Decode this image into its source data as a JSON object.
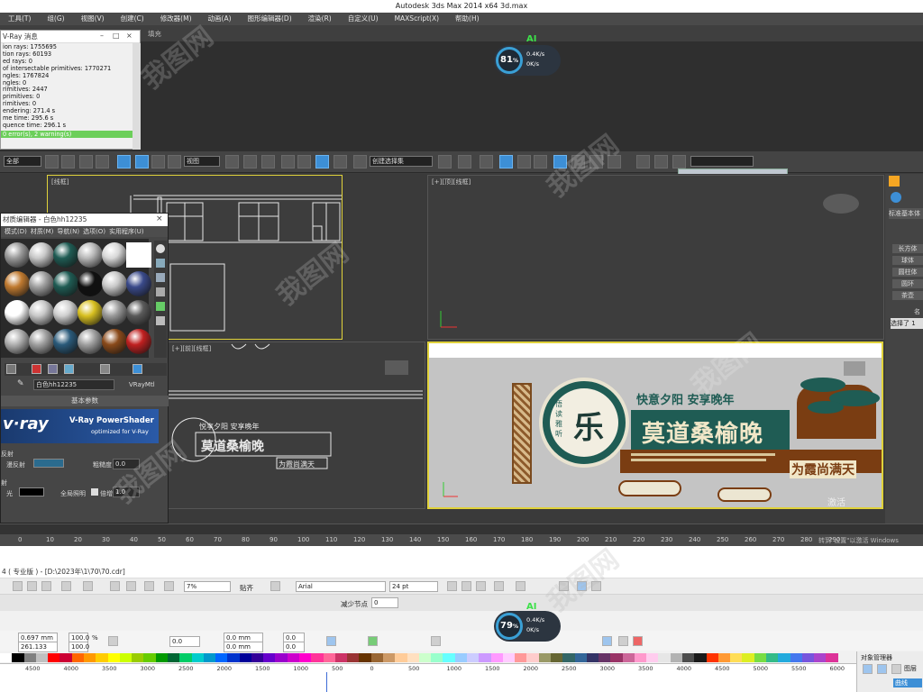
{
  "max": {
    "title": "Autodesk 3ds Max  2014 x64      3d.max",
    "menu": [
      "工具(T)",
      "组(G)",
      "视图(V)",
      "创建(C)",
      "修改器(M)",
      "动画(A)",
      "图形编辑器(D)",
      "渲染(R)",
      "自定义(U)",
      "MAXScript(X)",
      "帮助(H)"
    ],
    "fill_label": "填充",
    "select_filter": "全部",
    "view_dropdown": "视图",
    "selection_set": "创建选择集",
    "viewport_labels": {
      "tl": "[线框]",
      "tr": "[+][顶][线框]",
      "bl": "[+][前][线框]"
    },
    "right_panel": {
      "std": "标准基本体",
      "items": [
        "长方体",
        "球体",
        "圆柱体",
        "圆环",
        "茶壶"
      ],
      "sel": "选择了 1",
      "name": "名"
    },
    "timeline_ticks": [
      "0",
      "10",
      "20",
      "30",
      "40",
      "50",
      "60",
      "70",
      "80",
      "90",
      "100",
      "110",
      "120",
      "130",
      "140",
      "150",
      "160",
      "170",
      "180",
      "190",
      "200",
      "210",
      "220",
      "230",
      "240",
      "250",
      "260",
      "270",
      "280",
      "290"
    ],
    "windows_activate": "激活 Windows",
    "windows_activate_sub": "转到\"设置\"以激活 Windows"
  },
  "vray": {
    "title": "V-Ray 消息",
    "log": [
      "ion rays: 1755695",
      "tion rays: 60193",
      "ed rays: 0",
      "of intersectable primitives: 1770271",
      "ngles: 1767824",
      "ngles: 0",
      "rimitives: 2447",
      " primitives: 0",
      "rimitives: 0",
      "endering: 271.4 s",
      "me time: 295.6 s",
      "quence time: 296.1 s"
    ],
    "status": "0 error(s), 2 warning(s)"
  },
  "mated": {
    "title": "材质编辑器 - 白色hh12235",
    "menu": [
      "模式(D)",
      "材质(M)",
      "导航(N)",
      "选项(O)",
      "实用程序(U)"
    ],
    "material_name": "白色hh12235",
    "material_type": "VRayMtl",
    "section": "基本参数",
    "vray_logo": "v·ray",
    "vray_product": "V-Ray PowerShader",
    "vray_sub": "optimized for V-Ray",
    "diffuse": "漫反射",
    "roughness_label": "粗糙度",
    "roughness_value": "0.0",
    "reflect": "反射",
    "reflect_short": "光",
    "gloss": "全局照明",
    "multiplier": "倍增",
    "multiplier_value": "1.0",
    "refract": "射"
  },
  "sign": {
    "line1": "快意夕阳  安享晚年",
    "main": "莫道桑榆晚",
    "tail": "为霞尚满天",
    "circle": "乐",
    "side": "悟读雅听"
  },
  "speed_top": {
    "ai": "AI",
    "pct": "81",
    "unit": "%",
    "up": "0.4K/s",
    "down": "0K/s"
  },
  "speed_bottom": {
    "ai": "AI",
    "pct": "79",
    "unit": "%",
    "up": "0.4K/s",
    "down": "0K/s"
  },
  "corel": {
    "title": "4 ( 专业版 ) - [D:\\2023年\\1\\70\\70.cdr]",
    "zoom": "7%",
    "snap": "贴齐",
    "font": "Arial",
    "size": "24 pt",
    "width": "0.697 mm",
    "height": "261.133 mm",
    "scale_x": "100.0",
    "scale_y": "100.0",
    "pct": "%",
    "angle": "0.0",
    "x_off": "0.0 mm",
    "y_off": "0.0 mm",
    "reduce_nodes": "减少节点",
    "reduce_value": "0",
    "obj_manager": "对象管理器",
    "layer": "图层",
    "curve": "曲线",
    "ruler": [
      "4500",
      "4000",
      "3500",
      "3000",
      "2500",
      "2000",
      "1500",
      "1000",
      "500",
      "0",
      "500",
      "1000",
      "1500",
      "2000",
      "2500",
      "3000",
      "3500",
      "4000",
      "4500",
      "5000",
      "5500",
      "6000"
    ],
    "palette": [
      "#ffffff",
      "#000000",
      "#808080",
      "#c0c0c0",
      "#ff0000",
      "#cc0033",
      "#ff6600",
      "#ff9900",
      "#ffcc00",
      "#ffff00",
      "#ccff00",
      "#99cc00",
      "#66cc00",
      "#009900",
      "#006633",
      "#00cc66",
      "#00cccc",
      "#0099cc",
      "#0066ff",
      "#0033cc",
      "#000099",
      "#330099",
      "#6600cc",
      "#9900cc",
      "#cc00cc",
      "#ff00cc",
      "#ff3399",
      "#ff6699",
      "#cc3366",
      "#993333",
      "#663300",
      "#996633",
      "#cc9966",
      "#ffcc99",
      "#ffe0c0",
      "#ccffcc",
      "#99ffcc",
      "#66ffff",
      "#99ccff",
      "#ccccff",
      "#cc99ff",
      "#ff99ff",
      "#ffccff",
      "#ff9999",
      "#ffcccc",
      "#999966",
      "#666633",
      "#336666",
      "#336699",
      "#333366",
      "#663366",
      "#993366",
      "#cc6699",
      "#ff99cc",
      "#ffccee",
      "#e6e6e6",
      "#b3b3b3",
      "#4d4d4d",
      "#1a1a1a",
      "#ff3300",
      "#ff9933",
      "#ffdd55",
      "#ddee22",
      "#77dd44",
      "#33bb88",
      "#22aadd",
      "#4477ee",
      "#7755dd",
      "#aa44cc",
      "#dd3399"
    ]
  },
  "watermark": "我图网"
}
